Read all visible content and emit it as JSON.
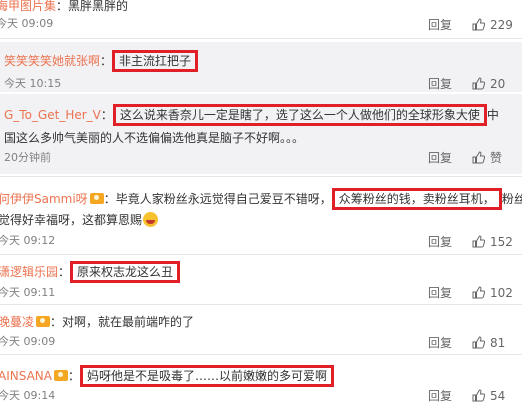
{
  "actions": {
    "reply_label": "回复",
    "like_label": "赞"
  },
  "comments": [
    {
      "user": "海甲图片集",
      "sep": "：",
      "text": "黑胖黑胖的",
      "time": "今天 09:09",
      "likes": "229"
    },
    {
      "user": "笑笑笑笑她就张啊",
      "sep": "：",
      "text": "非主流扛把子",
      "time": "今天 10:15",
      "likes": "20"
    },
    {
      "user": "G_To_Get_Her_V",
      "sep": "：",
      "text": "这么说来香奈儿一定是瞎了，选了这么一个人做他们的全球形象大使",
      "text2": "国这么多帅气美丽的人不选偏偏选他真是脑子不好啊。。。",
      "time": "20分钟前"
    },
    {
      "user": "何伊伊Sammi呀",
      "sep": "：",
      "text_before": "毕竟人家粉丝永远觉得自己爱豆不错呀，",
      "text_hl": "众筹粉丝的钱，卖粉丝耳机，",
      "text2": "觉得好幸福呀，这都算恩赐",
      "time": "今天 09:12",
      "likes": "152"
    },
    {
      "user": "潇逻辑乐园",
      "sep": "：",
      "text": "原来权志龙这么丑",
      "time": "今天 09:11",
      "likes": "102"
    },
    {
      "user": "晚蔓凌",
      "sep": "：",
      "text": "对啊，就在最前端咋的了",
      "time": "今天 09:09",
      "likes": "81"
    },
    {
      "user": "AINSANA",
      "sep": "：",
      "text": "妈呀他是不是吸毒了……以前嫩嫩的多可爱啊",
      "time": "今天 09:14",
      "likes": "54"
    }
  ],
  "colors": {
    "highlight_border": "#e01f26",
    "username": "#eb7350",
    "reply_bg": "#f2f2f5"
  },
  "icons": [
    "thumbs-up-icon",
    "vip-badge-icon",
    "laugh-emoji-icon"
  ]
}
